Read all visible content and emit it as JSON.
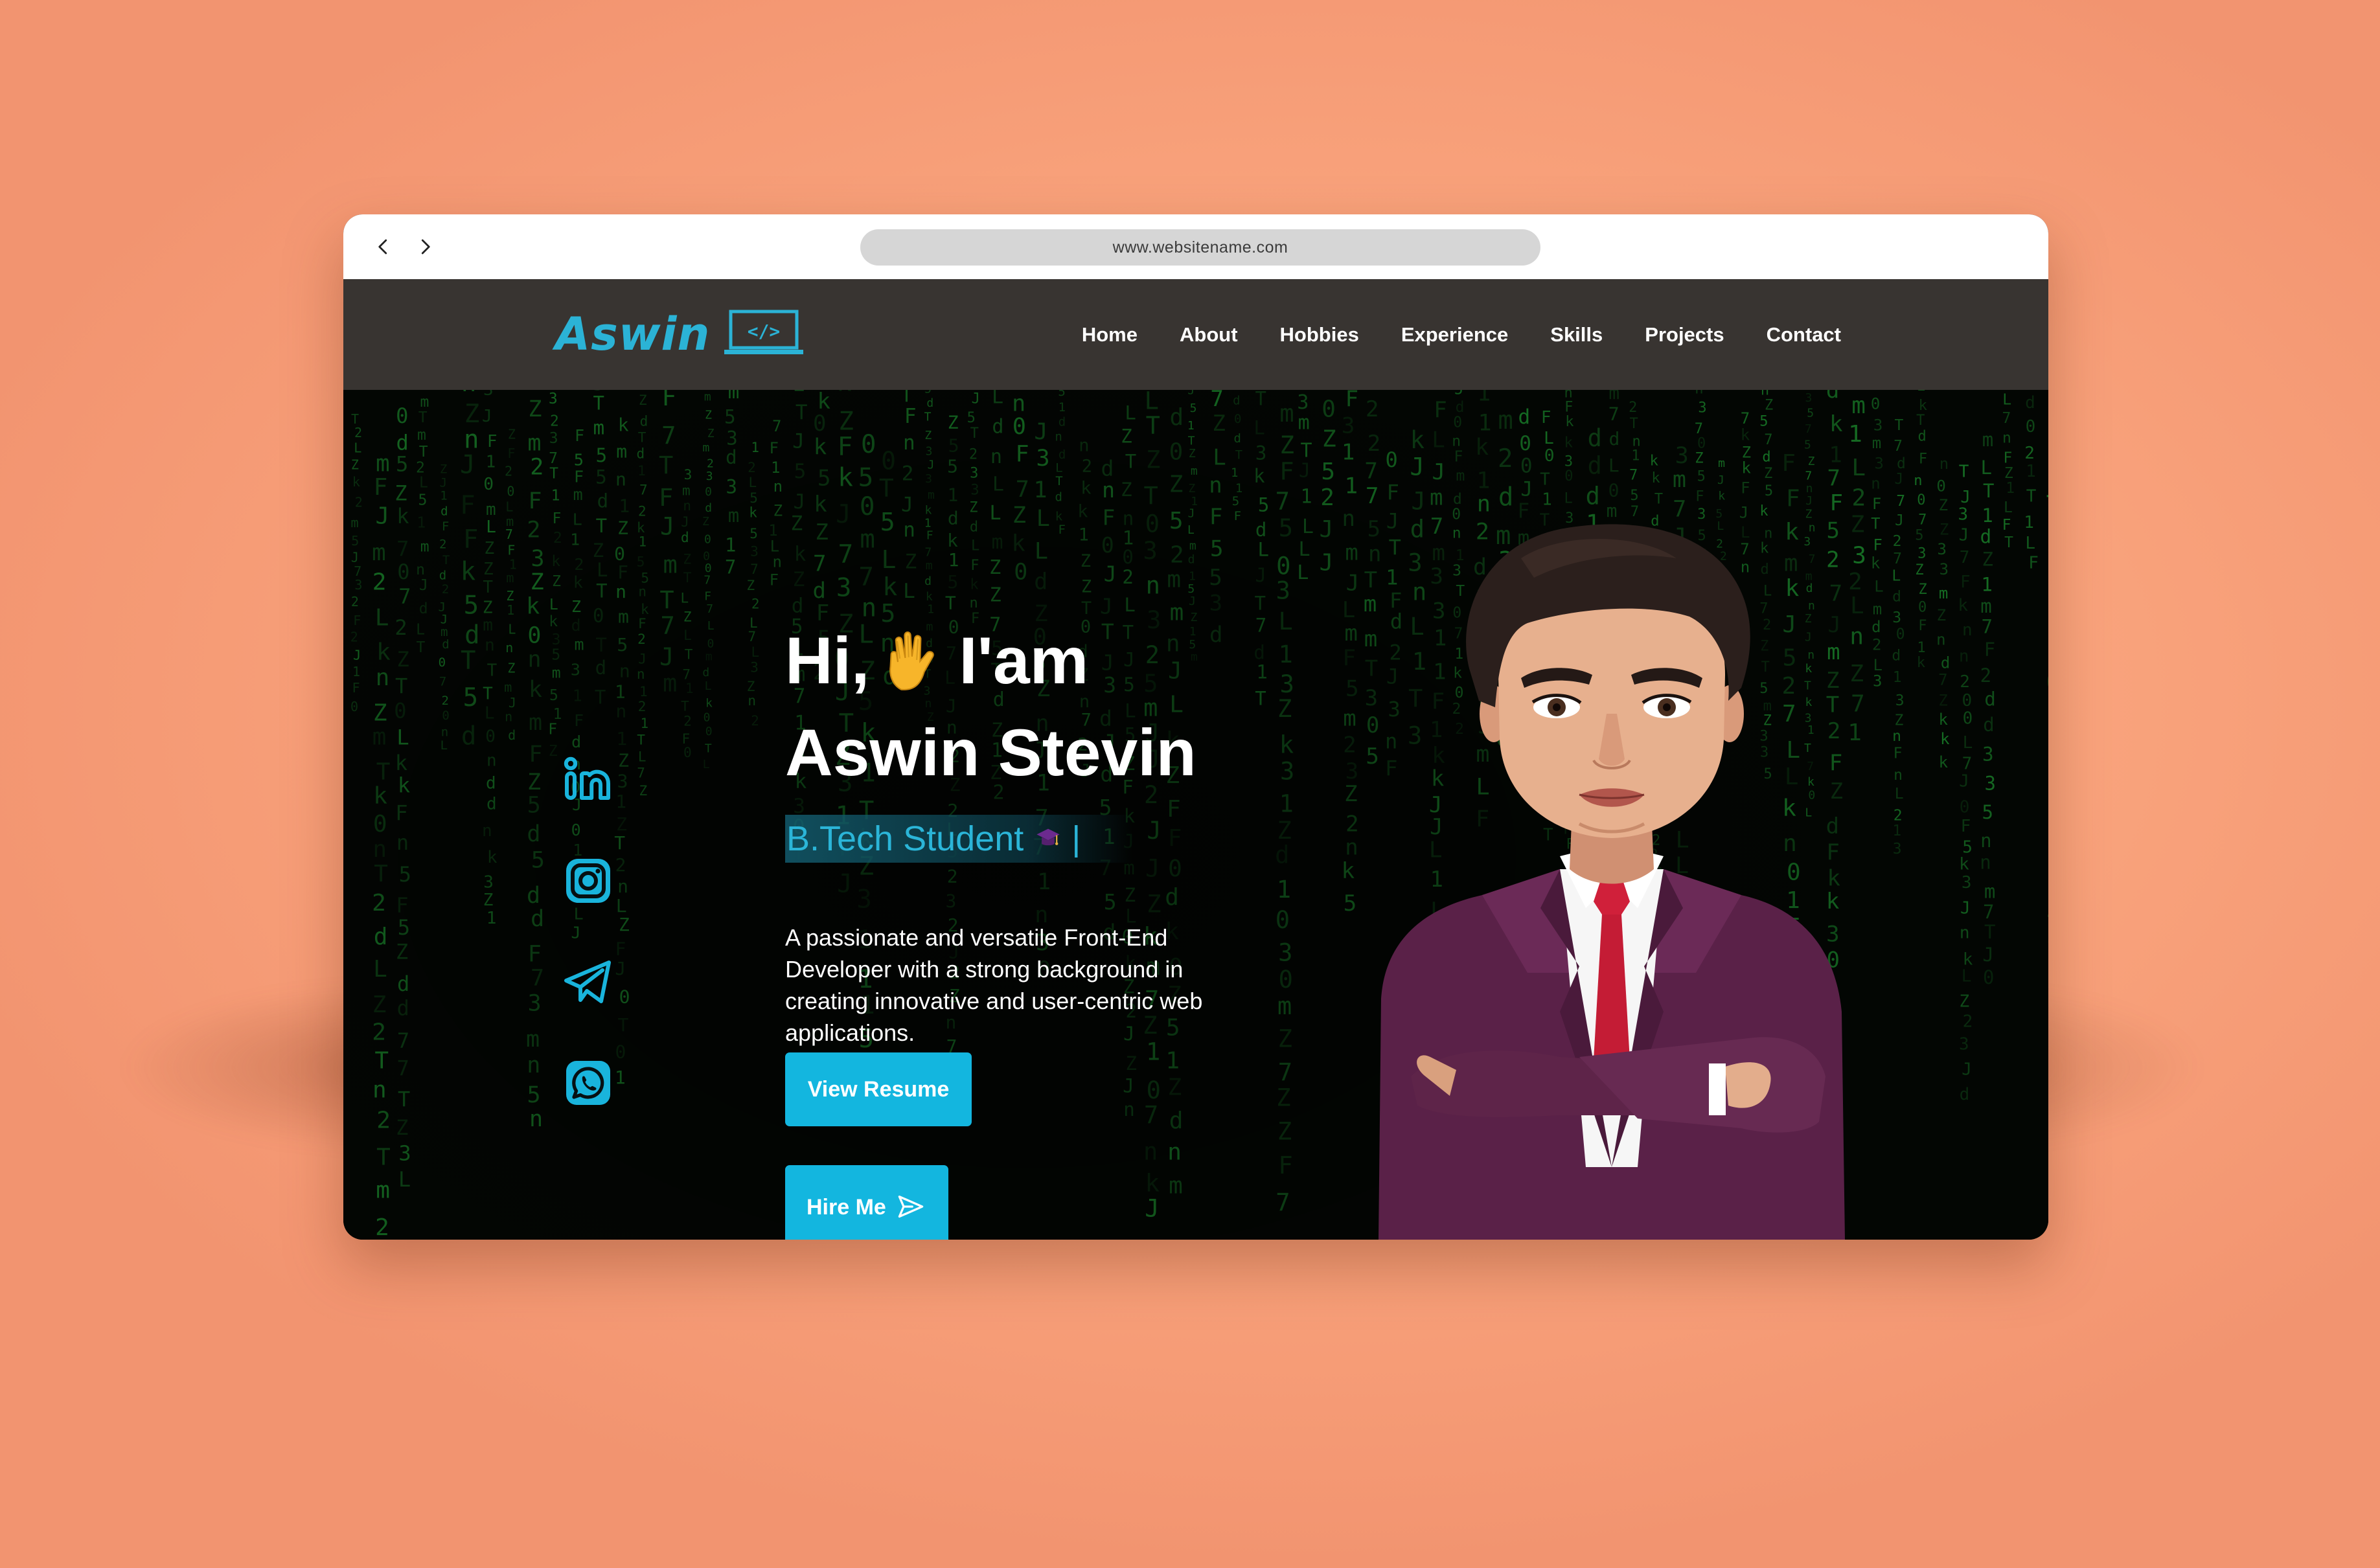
{
  "browser": {
    "url": "www.websitename.com",
    "back_icon": "chevron-left-icon",
    "forward_icon": "chevron-right-icon"
  },
  "header": {
    "logo_text": "Aswin",
    "logo_icon": "laptop-code-icon",
    "nav": [
      "Home",
      "About",
      "Hobbies",
      "Experience",
      "Skills",
      "Projects",
      "Contact"
    ]
  },
  "hero": {
    "greeting_before": "Hi,",
    "greeting_icon": "waving-hand-icon",
    "greeting_after": "I'am",
    "name": "Aswin Stevin",
    "role": "B.Tech Student",
    "role_icon": "graduation-cap-icon",
    "cursor": "|",
    "bio": "A passionate and versatile Front-End Developer with a strong background in creating innovative and user-centric web applications.",
    "resume_button": "View Resume",
    "hire_button": "Hire Me",
    "hire_icon": "send-icon",
    "socials": [
      "linkedin-icon",
      "instagram-icon",
      "telegram-icon",
      "whatsapp-icon"
    ],
    "avatar": "cartoon-avatar-illustration"
  },
  "colors": {
    "page_background": "#f9a37c",
    "header_background": "#383431",
    "accent": "#13b6df",
    "logo": "#2bb3d6",
    "matrix_green": "#1e9a32"
  }
}
